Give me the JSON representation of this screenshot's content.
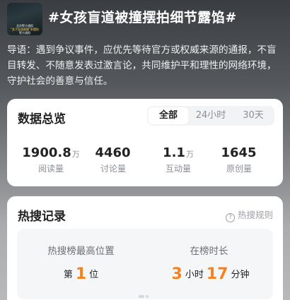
{
  "topic": {
    "title": "#女孩盲道被撞摆拍细节露馅#",
    "thumbnail_caption": [
      "北京警方通报",
      "\"女子盲道被撞\"系摆拍",
      "警方通报"
    ]
  },
  "intro": "导语：遇到争议事件，应优先等待官方或权威来源的通报，不盲目转发、不随意发表过激言论，共同维护平和理性的网络环境，守护社会的善意与信任。",
  "stats": {
    "title": "数据总览",
    "tabs": [
      "全部",
      "24小时",
      "30天"
    ],
    "active_tab": "全部",
    "metrics": [
      {
        "value": "1900.8",
        "unit": "万",
        "label": "阅读量"
      },
      {
        "value": "4460",
        "unit": "",
        "label": "讨论量"
      },
      {
        "value": "1.1",
        "unit": "万",
        "label": "互动量"
      },
      {
        "value": "1645",
        "unit": "",
        "label": "原创量"
      }
    ]
  },
  "hot": {
    "title": "热搜记录",
    "rule_icon": "question-circle-icon",
    "rule_label": "热搜规则",
    "peak": {
      "label": "热搜榜最高位置",
      "prefix": "第",
      "value": "1",
      "suffix": "位"
    },
    "duration": {
      "label": "在榜时长",
      "hours": "3",
      "hours_unit": "小时",
      "minutes": "17",
      "minutes_unit": "分钟"
    }
  },
  "colors": {
    "accent": "#f5821f"
  }
}
